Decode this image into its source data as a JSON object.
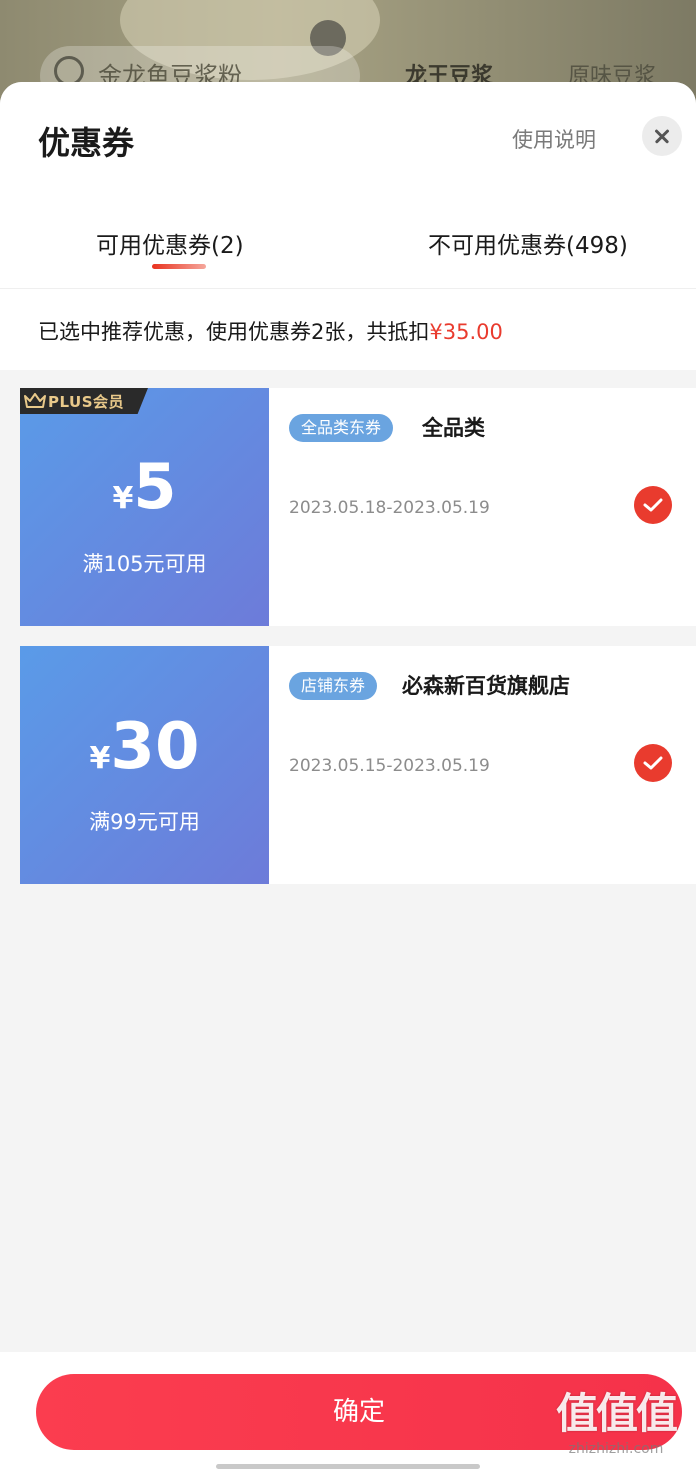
{
  "background_app": {
    "search_placeholder": "金龙鱼豆浆粉",
    "chip1": "龙王豆浆",
    "chip2": "原味豆浆"
  },
  "sheet": {
    "title": "优惠券",
    "help_link": "使用说明",
    "tabs": [
      {
        "label": "可用优惠券(2)",
        "active": true
      },
      {
        "label": "不可用优惠券(498)",
        "active": false
      }
    ],
    "summary_prefix": "已选中推荐优惠，使用优惠券2张，共抵扣",
    "summary_amount": "¥35.00"
  },
  "coupons": [
    {
      "badge": "PLUS会员",
      "currency": "¥",
      "amount": "5",
      "threshold": "满105元可用",
      "tag": "全品类东券",
      "name": "全品类",
      "validity": "2023.05.18-2023.05.19",
      "selected": true
    },
    {
      "currency": "¥",
      "amount": "30",
      "threshold": "满99元可用",
      "tag": "店铺东券",
      "name": "必森新百货旗舰店",
      "validity": "2023.05.15-2023.05.19",
      "selected": true
    }
  ],
  "footer": {
    "confirm_label": "确定"
  },
  "watermark": {
    "big": "值值值",
    "small": "zhizhizhi.com"
  },
  "colors": {
    "accent_red": "#e93b2e",
    "coupon_blue": "#5a9be8",
    "tag_blue": "#6aa4e0",
    "confirm_red": "#fb3d4f"
  }
}
